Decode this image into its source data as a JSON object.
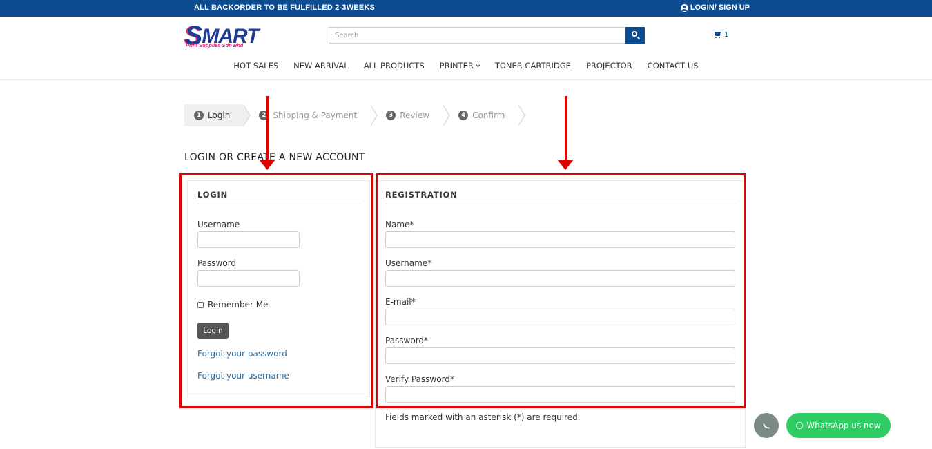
{
  "topbar": {
    "message": "ALL BACKORDER TO BE FULFILLED 2-3WEEKS",
    "login_link": "LOGIN/ SIGN UP",
    "color": "#0d4d8f"
  },
  "logo": {
    "word": "MART",
    "initial": "S",
    "tagline": "Print Supplies Sdn Bhd"
  },
  "search": {
    "placeholder": "Search",
    "button_icon": "search-icon"
  },
  "cart": {
    "count": "1",
    "icon": "cart-icon"
  },
  "nav": {
    "items": [
      "HOT SALES",
      "NEW ARRIVAL",
      "ALL PRODUCTS",
      "PRINTER",
      "TONER CARTRIDGE",
      "PROJECTOR",
      "CONTACT US"
    ]
  },
  "checkout_steps": [
    {
      "num": "1",
      "label": "Login",
      "active": true
    },
    {
      "num": "2",
      "label": "Shipping & Payment",
      "active": false
    },
    {
      "num": "3",
      "label": "Review",
      "active": false
    },
    {
      "num": "4",
      "label": "Confirm",
      "active": false
    }
  ],
  "page_title": "LOGIN OR CREATE A NEW ACCOUNT",
  "login": {
    "heading": "LOGIN",
    "username_label": "Username",
    "password_label": "Password",
    "remember_label": "Remember Me",
    "button_label": "Login",
    "forgot_password": "Forgot your password",
    "forgot_username": "Forgot your username"
  },
  "registration": {
    "heading": "REGISTRATION",
    "fields": [
      "Name*",
      "Username*",
      "E-mail*",
      "Password*",
      "Verify Password*"
    ],
    "required_note": "Fields marked with an asterisk (*) are required."
  },
  "floating": {
    "phone_icon": "phone-icon",
    "whatsapp_label": "WhatsApp us now",
    "whatsapp_color": "#2ecc63"
  },
  "annotation_color": "#e00000"
}
